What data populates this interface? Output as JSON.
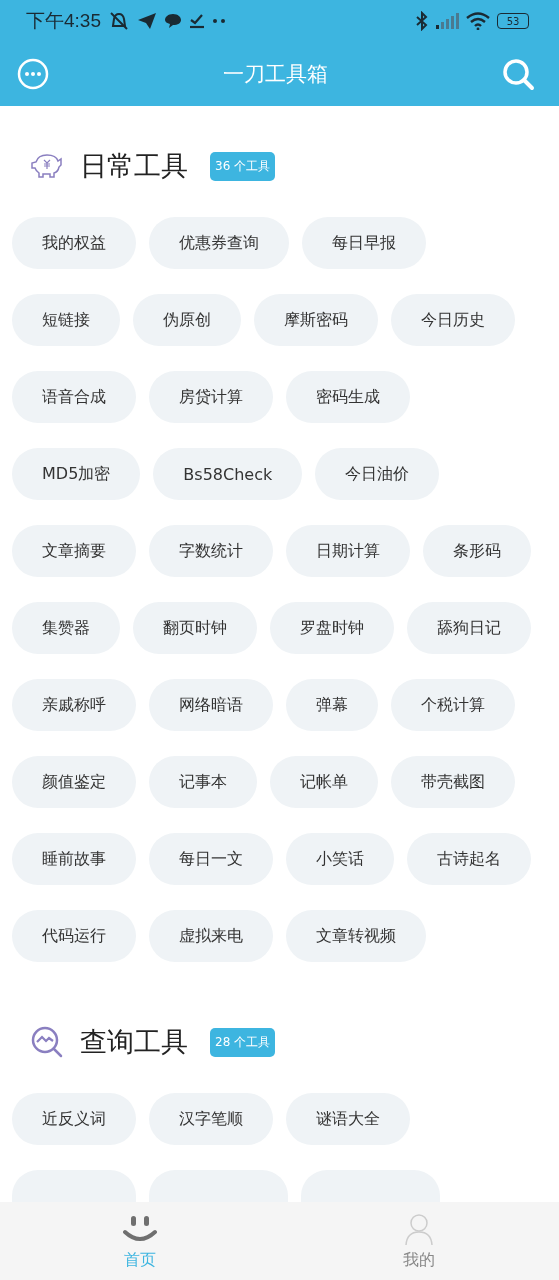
{
  "status_bar": {
    "time": "下午4:35",
    "battery": "53"
  },
  "header": {
    "title": "一刀工具箱"
  },
  "sections": [
    {
      "kind": "daily",
      "title": "日常工具",
      "count": "36 个工具",
      "tools": [
        "我的权益",
        "优惠券查询",
        "每日早报",
        "短链接",
        "伪原创",
        "摩斯密码",
        "今日历史",
        "语音合成",
        "房贷计算",
        "密码生成",
        "MD5加密",
        "Bs58Check",
        "今日油价",
        "文章摘要",
        "字数统计",
        "日期计算",
        "条形码",
        "集赞器",
        "翻页时钟",
        "罗盘时钟",
        "舔狗日记",
        "亲戚称呼",
        "网络暗语",
        "弹幕",
        "个税计算",
        "颜值鉴定",
        "记事本",
        "记帐单",
        "带壳截图",
        "睡前故事",
        "每日一文",
        "小笑话",
        "古诗起名",
        "代码运行",
        "虚拟来电",
        "文章转视频"
      ]
    },
    {
      "kind": "query",
      "title": "查询工具",
      "count": "28 个工具",
      "tools": [
        "近反义词",
        "汉字笔顺",
        "谜语大全"
      ]
    }
  ],
  "nav": [
    {
      "kind": "home",
      "label": "首页",
      "selected": true
    },
    {
      "kind": "me",
      "label": "我的",
      "selected": false
    }
  ]
}
